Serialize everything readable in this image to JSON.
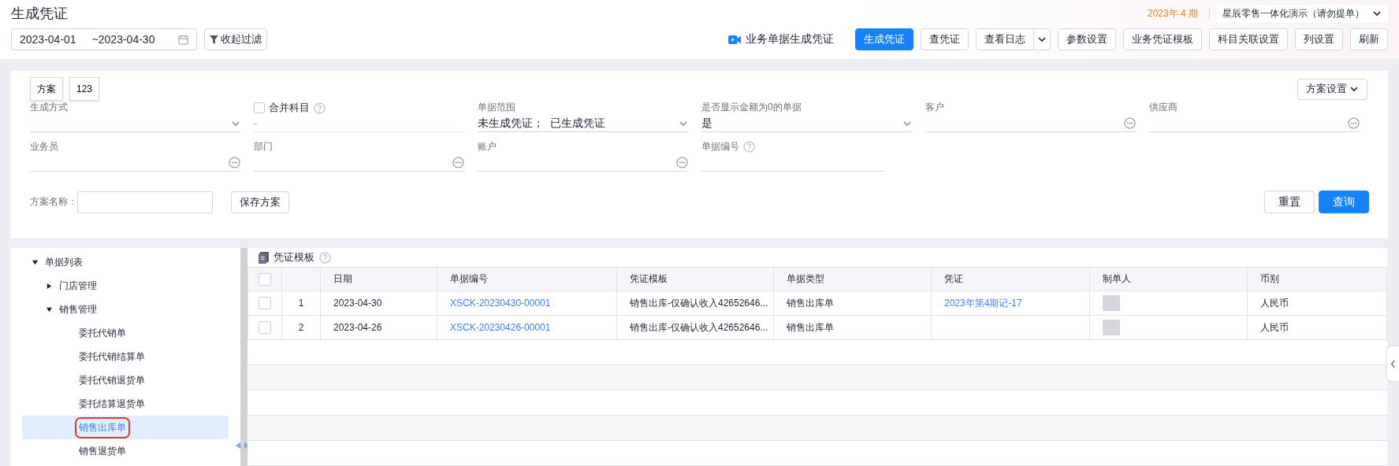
{
  "header": {
    "title": "生成凭证",
    "period": "2023年 4 期",
    "company": "星辰零售一体化演示（请勿提单）",
    "date_start": "2023-04-01",
    "date_end": "~2023-04-30",
    "filter_toggle": "收起过滤",
    "actions": [
      {
        "label": "业务单据生成凭证",
        "kind": "video-link"
      },
      {
        "label": "生成凭证",
        "kind": "primary"
      },
      {
        "label": "查凭证",
        "kind": "default"
      },
      {
        "label": "查看日志",
        "kind": "split"
      },
      {
        "label": "参数设置",
        "kind": "default"
      },
      {
        "label": "业务凭证模板",
        "kind": "default"
      },
      {
        "label": "科目关联设置",
        "kind": "default"
      },
      {
        "label": "列设置",
        "kind": "default"
      },
      {
        "label": "刷新",
        "kind": "default"
      }
    ]
  },
  "filter": {
    "schemes": [
      "方案",
      "123"
    ],
    "scheme_settings": "方案设置",
    "fields": [
      {
        "label": "生成方式",
        "kind": "select"
      },
      {
        "label": "合并科目",
        "kind": "checkbox",
        "checked": false,
        "help": true,
        "placeholder": "-"
      },
      {
        "label": "单据范围",
        "kind": "select",
        "value": "未生成凭证；  已生成凭证"
      },
      {
        "label": "是否显示金额为0的单据",
        "kind": "select",
        "value": "是"
      },
      {
        "label": "客户",
        "kind": "lookup"
      },
      {
        "label": "供应商",
        "kind": "lookup"
      },
      {
        "label": "业务员",
        "kind": "lookup"
      },
      {
        "label": "部门",
        "kind": "lookup"
      },
      {
        "label": "账户",
        "kind": "lookup"
      },
      {
        "label": "单据编号",
        "kind": "text",
        "help": true
      }
    ],
    "scheme_name_label": "方案名称：",
    "save_button": "保存方案",
    "reset_button": "重置",
    "query_button": "查询"
  },
  "tree": {
    "items": [
      {
        "label": "单据列表",
        "expanded": true,
        "selected": false,
        "children": [
          {
            "label": "门店管理",
            "expanded": false,
            "selected": false
          },
          {
            "label": "销售管理",
            "expanded": true,
            "selected": false,
            "children": [
              {
                "label": "委托代销单",
                "selected": false
              },
              {
                "label": "委托代销结算单",
                "selected": false
              },
              {
                "label": "委托代销退货单",
                "selected": false
              },
              {
                "label": "委托结算退货单",
                "selected": false
              },
              {
                "label": "销售出库单",
                "selected": true,
                "annotated": true
              },
              {
                "label": "销售退货单",
                "selected": false
              }
            ]
          }
        ]
      }
    ]
  },
  "table": {
    "title": "凭证模板",
    "all_checked": false,
    "columns": [
      "日期",
      "单据编号",
      "凭证模板",
      "单据类型",
      "凭证",
      "制单人",
      "币别"
    ],
    "rows": [
      {
        "checked": false,
        "index": "1",
        "date": "2023-04-30",
        "bill_no": "XSCK-20230430-00001",
        "template": "销售出库-仅确认收入42652646...",
        "bill_type": "销售出库单",
        "voucher": "2023年第4期记-17",
        "currency": "人民币"
      },
      {
        "checked": false,
        "index": "2",
        "date": "2023-04-26",
        "bill_no": "XSCK-20230426-00001",
        "template": "销售出库-仅确认收入42652646...",
        "bill_type": "销售出库单",
        "currency": "人民币"
      }
    ]
  }
}
